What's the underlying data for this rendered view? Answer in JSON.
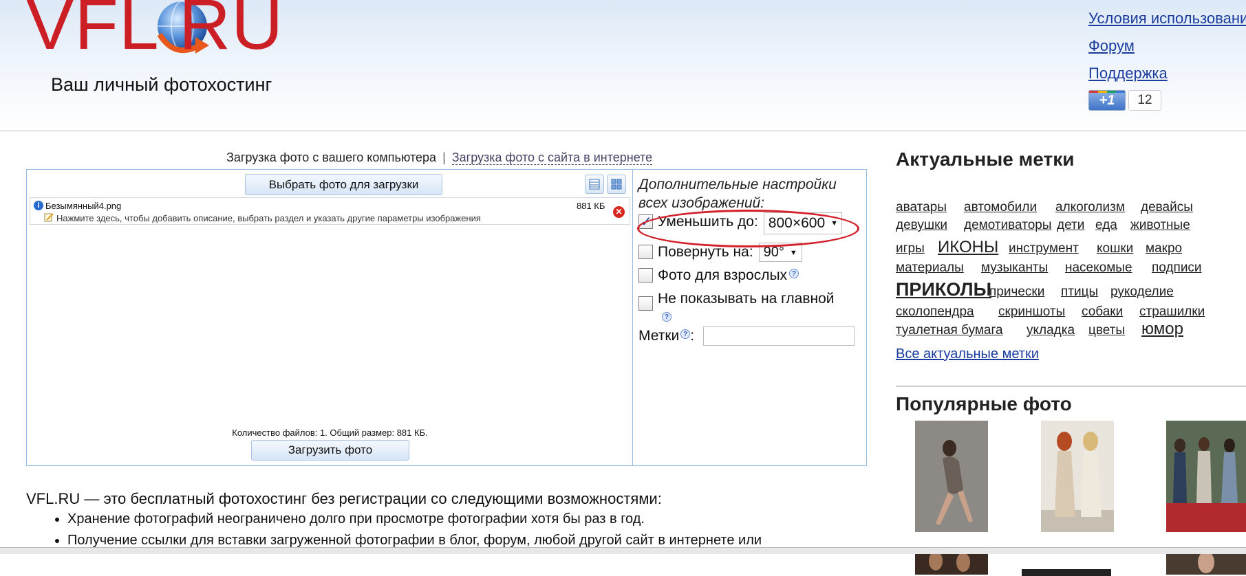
{
  "logo": {
    "part1": "VFL",
    "part2": "RU"
  },
  "header": {
    "tagline": "Ваш личный фотохостинг",
    "links": [
      "Условия использовани",
      "Форум",
      "Поддержка"
    ],
    "plusone": {
      "label": "+1",
      "count": "12"
    }
  },
  "upload": {
    "tab_active": "Загрузка фото с вашего компьютера",
    "separator": "|",
    "tab_alt": "Загрузка фото с сайта в интернете",
    "choose_button": "Выбрать фото для загрузки",
    "file": {
      "name": "Безымянный4.png",
      "size": "881 КБ",
      "hint": "Нажмите здесь, чтобы добавить описание, выбрать раздел и указать другие параметры изображения"
    },
    "summary": "Количество файлов: 1. Общий размер: 881 КБ.",
    "upload_button": "Загрузить фото"
  },
  "settings": {
    "title": "Дополнительные настройки всех изображений:",
    "resize": {
      "label": "Уменьшить до:",
      "value": "800×600",
      "checked": true
    },
    "rotate": {
      "label": "Повернуть на:",
      "value": "90°",
      "checked": false
    },
    "adult": {
      "label": "Фото для взрослых",
      "checked": false
    },
    "hide_main": {
      "label": "Не показывать на главной",
      "checked": false
    },
    "tags_label": "Метки",
    "tags_colon": ":"
  },
  "about": {
    "intro": "VFL.RU — это бесплатный фотохостинг без регистрации со следующими возможностями:",
    "items": [
      "Хранение фотографий неограничено долго при просмотре фотографии хотя бы раз в год.",
      "Получение ссылки для вставки загруженной фотографии в блог, форум, любой другой сайт в интернете или"
    ]
  },
  "sidebar": {
    "tags_heading": "Актуальные метки",
    "tags": [
      "аватары",
      "автомобили",
      "алкоголизм",
      "девайсы",
      "девушки",
      "демотиваторы",
      "дети",
      "еда",
      "животные",
      "игры",
      "ИКОНЫ",
      "инструмент",
      "кошки",
      "макро",
      "материалы",
      "музыканты",
      "насекомые",
      "подписи",
      "ПРИКОЛЫ",
      "прически",
      "птицы",
      "рукоделие",
      "сколопендра",
      "скриншоты",
      "собаки",
      "страшилки",
      "туалетная бумага",
      "укладка",
      "цветы",
      "юмор"
    ],
    "all_tags": "Все актуальные метки",
    "popular_heading": "Популярные фото"
  }
}
